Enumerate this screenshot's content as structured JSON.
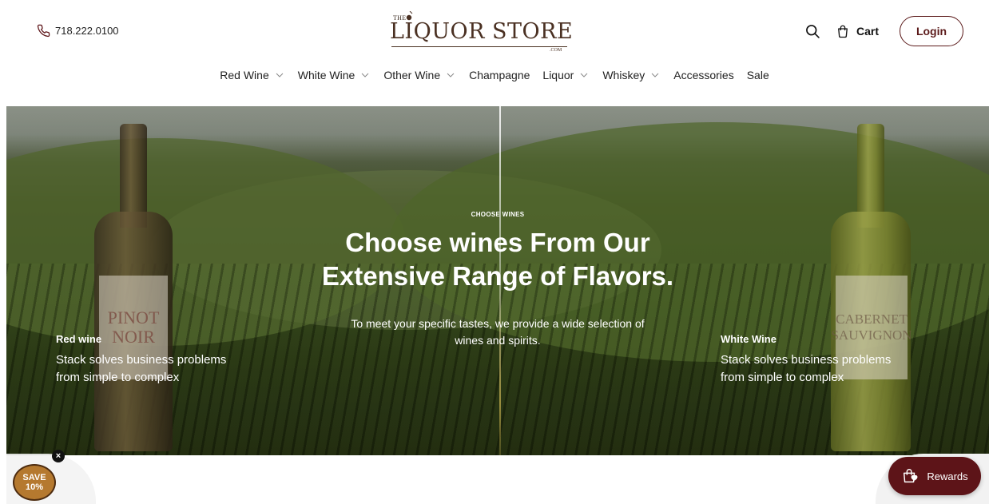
{
  "header": {
    "phone": "718.222.0100",
    "logo": {
      "the": "THE",
      "main": "LIQUOR STORE",
      "com": ".COM"
    },
    "cart_label": "Cart",
    "login_label": "Login"
  },
  "nav": {
    "items": [
      {
        "label": "Red Wine",
        "dropdown": true
      },
      {
        "label": "White Wine",
        "dropdown": true
      },
      {
        "label": "Other Wine",
        "dropdown": true
      },
      {
        "label": "Champagne",
        "dropdown": false
      },
      {
        "label": "Liquor",
        "dropdown": true
      },
      {
        "label": "Whiskey",
        "dropdown": true
      },
      {
        "label": "Accessories",
        "dropdown": false
      },
      {
        "label": "Sale",
        "dropdown": false
      }
    ]
  },
  "hero": {
    "eyebrow": "CHOOSE WINES",
    "title_line1": "Choose wines From Our",
    "title_line2": "Extensive Range of Flavors.",
    "subtitle_line1": "To meet your specific tastes, we provide a wide selection of",
    "subtitle_line2": "wines and spirits.",
    "left": {
      "title": "Red wine",
      "text_line1": "Stack solves business problems",
      "text_line2": "from simple to complex",
      "bottle_label_line1": "PINOT",
      "bottle_label_line2": "NOIR"
    },
    "right": {
      "title": "White Wine",
      "text_line1": "Stack solves business problems",
      "text_line2": "from simple to complex",
      "bottle_label_line1": "CABERNET",
      "bottle_label_line2": "SAUVIGNON"
    }
  },
  "floating": {
    "save_line1": "SAVE",
    "save_line2": "10%",
    "close_symbol": "×",
    "rewards_label": "Rewards"
  },
  "colors": {
    "brand": "#5d1418",
    "logo": "#4a3022",
    "save_badge": "#b5792f"
  }
}
